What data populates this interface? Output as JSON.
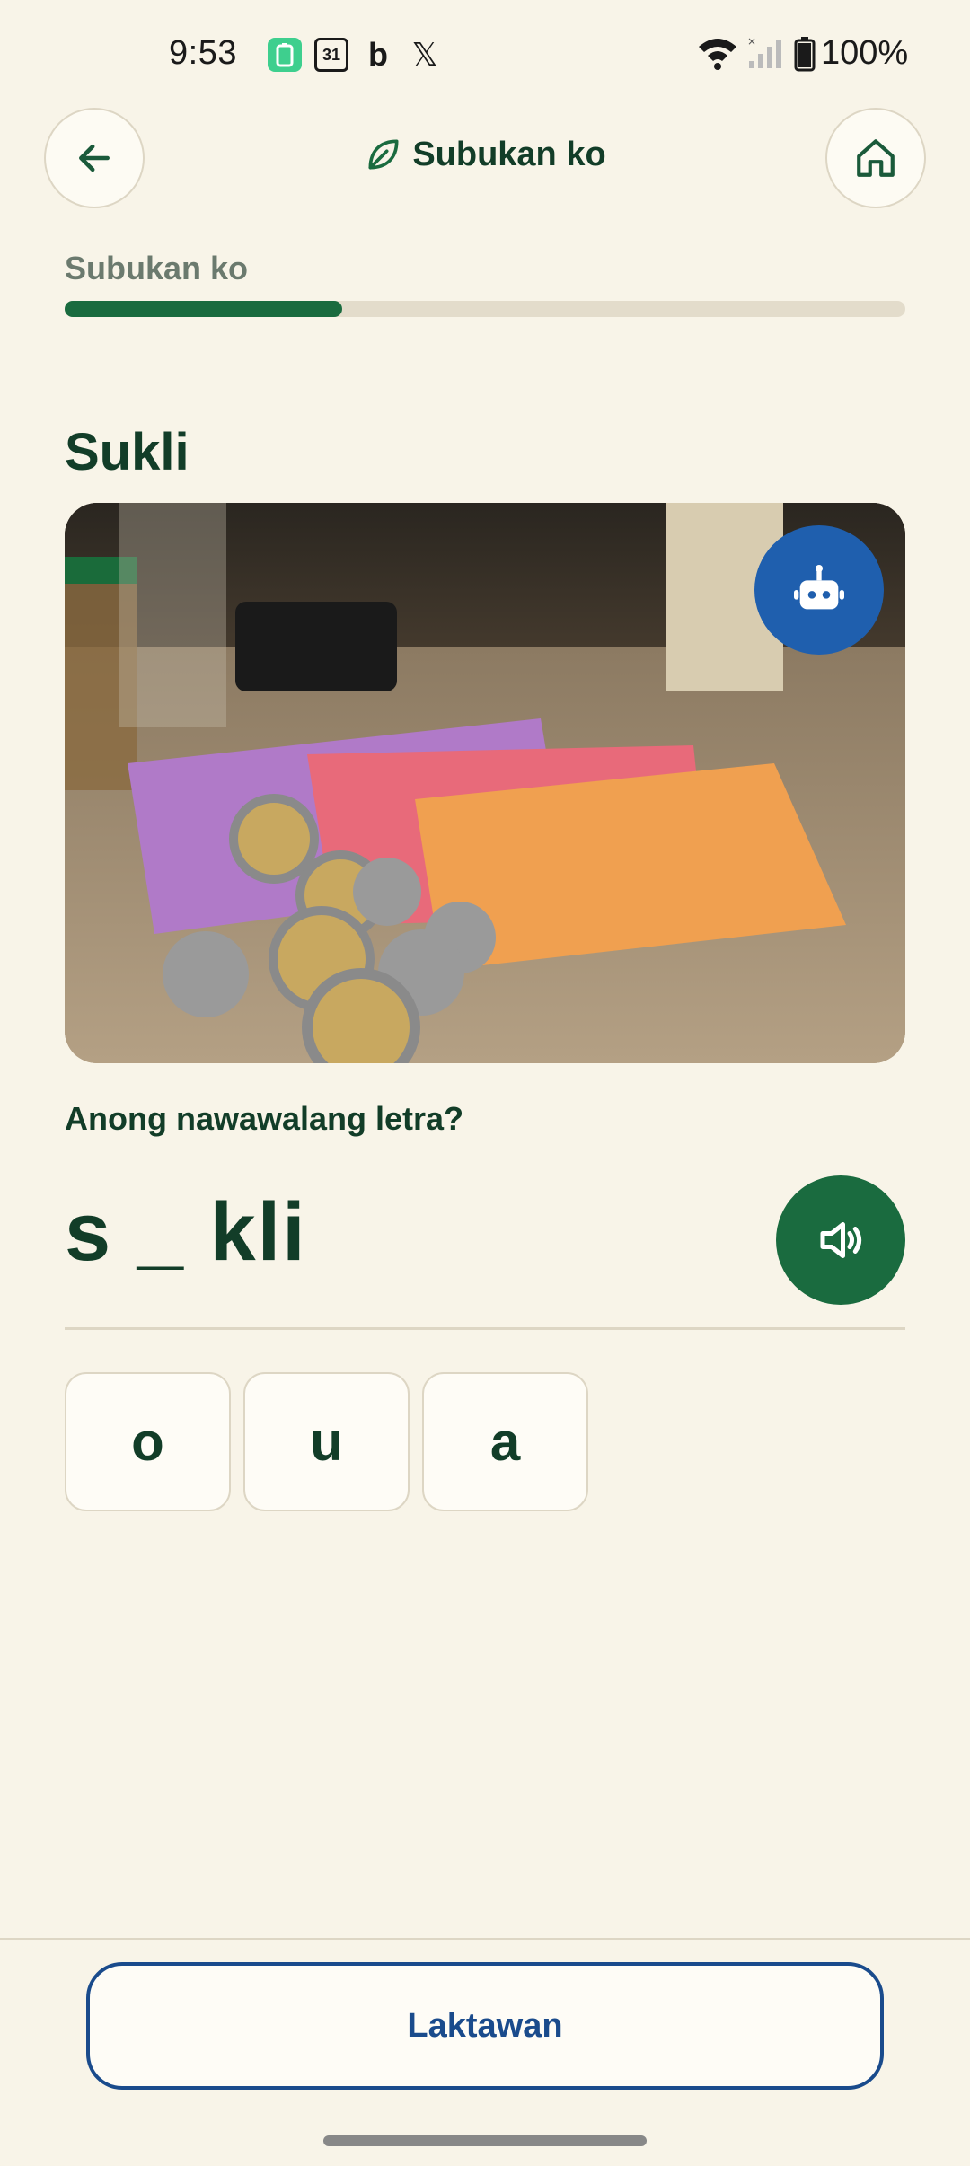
{
  "status_bar": {
    "time": "9:53",
    "calendar_day": "31",
    "bing_glyph": "b",
    "x_glyph": "𝕏",
    "battery_percent": "100%"
  },
  "header": {
    "title": "Subukan ko",
    "back_icon": "arrow-left-icon",
    "home_icon": "home-icon",
    "title_icon": "leaf-icon"
  },
  "progress": {
    "label": "Subukan ko",
    "value": 0.33
  },
  "exercise": {
    "word": "Sukli",
    "image_alt": "Philippine peso bills and coins on a store counter",
    "question": "Anong nawawalang letra?",
    "puzzle": "s _ kli",
    "choices": [
      {
        "label": "o"
      },
      {
        "label": "u"
      },
      {
        "label": "a"
      }
    ]
  },
  "footer": {
    "skip_label": "Laktawan"
  },
  "colors": {
    "background": "#f8f4e8",
    "primary_green": "#1a6b3f",
    "dark_text": "#123d28",
    "accent_blue": "#1f5fae",
    "skip_blue": "#1a4b8c"
  }
}
